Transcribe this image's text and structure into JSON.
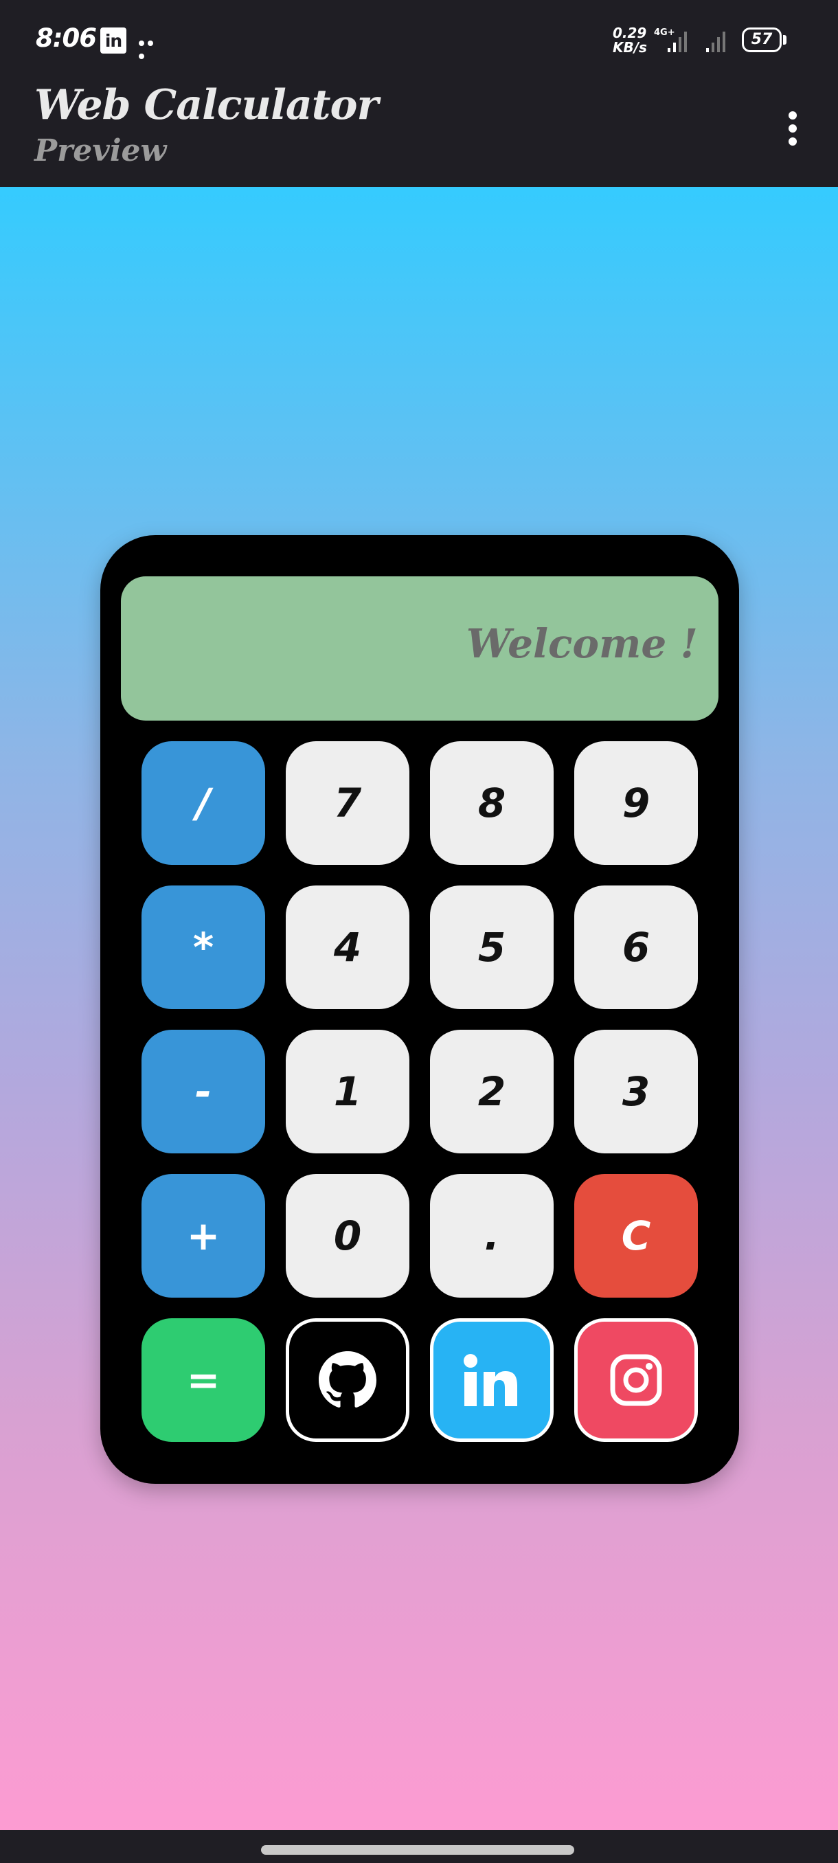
{
  "status_bar": {
    "time": "8:06",
    "notification_icons": [
      "linkedin-icon",
      "more-dots-icon"
    ],
    "net_speed_value": "0.29",
    "net_speed_unit": "KB/s",
    "network_type": "4G+",
    "battery_level": "57"
  },
  "app_bar": {
    "title": "Web Calculator",
    "subtitle": "Preview"
  },
  "calculator": {
    "display_text": "Welcome !",
    "keys": [
      {
        "label": "/",
        "type": "operator"
      },
      {
        "label": "7",
        "type": "number"
      },
      {
        "label": "8",
        "type": "number"
      },
      {
        "label": "9",
        "type": "number"
      },
      {
        "label": "*",
        "type": "operator"
      },
      {
        "label": "4",
        "type": "number"
      },
      {
        "label": "5",
        "type": "number"
      },
      {
        "label": "6",
        "type": "number"
      },
      {
        "label": "-",
        "type": "operator"
      },
      {
        "label": "1",
        "type": "number"
      },
      {
        "label": "2",
        "type": "number"
      },
      {
        "label": "3",
        "type": "number"
      },
      {
        "label": "+",
        "type": "operator"
      },
      {
        "label": "0",
        "type": "number"
      },
      {
        "label": ".",
        "type": "number"
      },
      {
        "label": "C",
        "type": "clear"
      },
      {
        "label": "=",
        "type": "equals"
      }
    ],
    "social_links": [
      {
        "icon": "github-icon"
      },
      {
        "icon": "linkedin-icon"
      },
      {
        "icon": "instagram-icon"
      }
    ]
  },
  "colors": {
    "display_bg": "#93c59b",
    "operator_key": "#3895d8",
    "number_key": "#eeeeee",
    "clear_key": "#e54d3d",
    "equals_key": "#2ecc71",
    "linkedin": "#27b3f4",
    "instagram": "#ef4962",
    "gradient_top": "#35cbfe",
    "gradient_bottom": "#fd9cd2"
  }
}
